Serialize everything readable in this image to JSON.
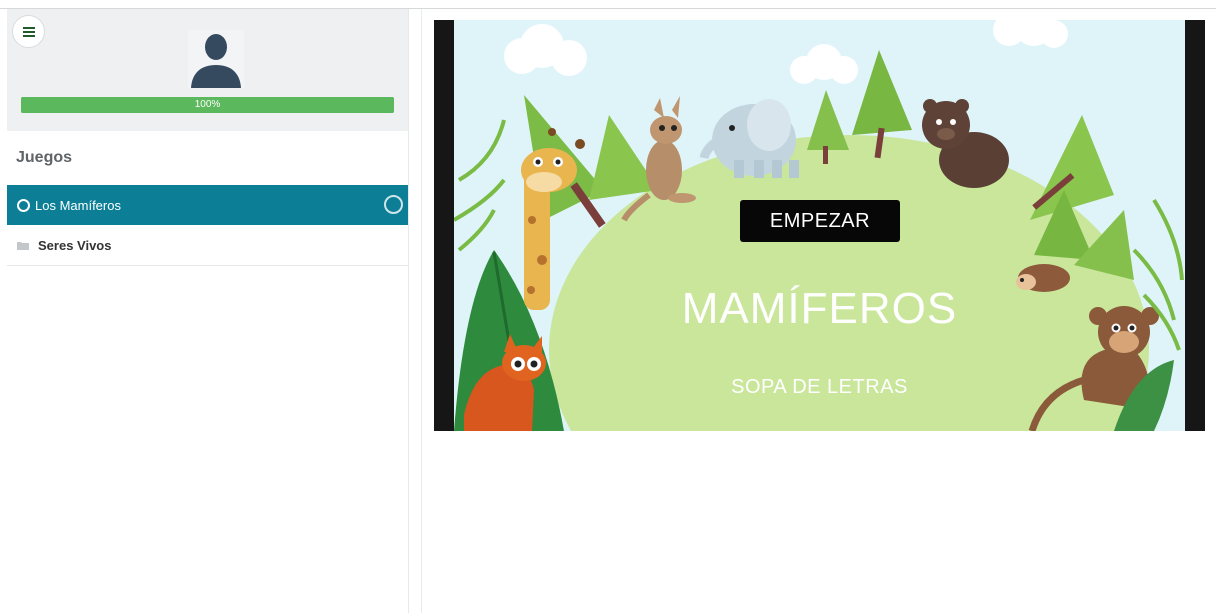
{
  "sidebar": {
    "progress_percent": 100,
    "progress_text": "100%",
    "section_title": "Juegos",
    "items": [
      {
        "label": "Los Mamíferos",
        "active": true,
        "icon": "ring-icon"
      },
      {
        "label": "Seres Vivos",
        "active": false,
        "icon": "folder-icon"
      }
    ]
  },
  "game": {
    "start_label": "EMPEZAR",
    "title": "MAMÍFEROS",
    "subtitle": "SOPA DE LETRAS"
  },
  "colors": {
    "accent": "#0c7f97",
    "progress": "#5cb85c",
    "hill": "#c9e69b",
    "sky": "#dff4f9"
  }
}
